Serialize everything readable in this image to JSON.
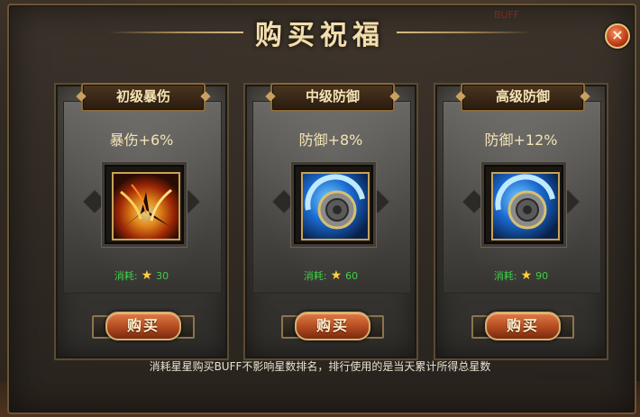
{
  "dialog": {
    "title": "购买祝福",
    "close_label": "×",
    "buff_label": "BUFF"
  },
  "cards": [
    {
      "name": "初级暴伤",
      "bonus": "暴伤+6%",
      "cost_label": "消耗:",
      "cost_value": "30",
      "buy_label": "购买",
      "icon": "fire-slash-icon"
    },
    {
      "name": "中级防御",
      "bonus": "防御+8%",
      "cost_label": "消耗:",
      "cost_value": "60",
      "buy_label": "购买",
      "icon": "blue-shield-icon"
    },
    {
      "name": "高级防御",
      "bonus": "防御+12%",
      "cost_label": "消耗:",
      "cost_value": "90",
      "buy_label": "购买",
      "icon": "blue-shield-icon"
    }
  ],
  "footer_note": "消耗星星购买BUFF不影响星数排名，排行使用的是当天累计所得总星数",
  "colors": {
    "cost_green": "#3fd04a",
    "star": "#ffd23a",
    "title": "#f2dfb0"
  }
}
